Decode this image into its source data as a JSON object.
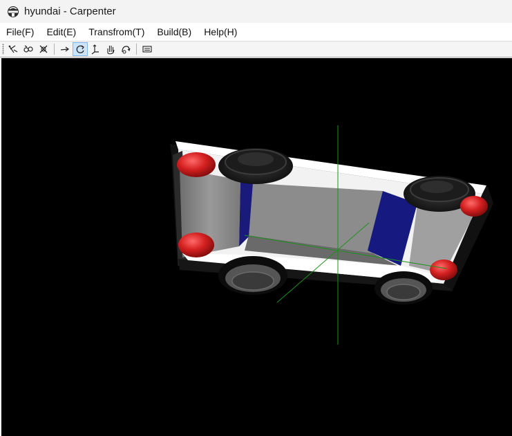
{
  "window": {
    "title": "hyundai - Carpenter",
    "app_icon": "carpenter-app-icon"
  },
  "menu": {
    "items": [
      {
        "label": "File(F)"
      },
      {
        "label": "Edit(E)"
      },
      {
        "label": "Transfrom(T)"
      },
      {
        "label": "Build(B)"
      },
      {
        "label": "Help(H)"
      }
    ]
  },
  "toolbar": {
    "buttons": [
      {
        "icon": "select-icon"
      },
      {
        "icon": "link-icon"
      },
      {
        "icon": "delete-icon"
      },
      {
        "icon": "move-icon"
      },
      {
        "icon": "rotate-icon",
        "active": true
      },
      {
        "icon": "axis-icon"
      },
      {
        "icon": "pan-hand-icon"
      },
      {
        "icon": "orbit-icon"
      },
      {
        "icon": "build-icon"
      }
    ]
  },
  "viewport": {
    "background": "#000000",
    "axis_color": "#1f8f1f",
    "car_colors": {
      "body": "#ffffff",
      "panel": "#8a8a8a",
      "stripe": "#1a1a7a",
      "wheel": "#1e1e1e",
      "light": "#d42020"
    }
  }
}
